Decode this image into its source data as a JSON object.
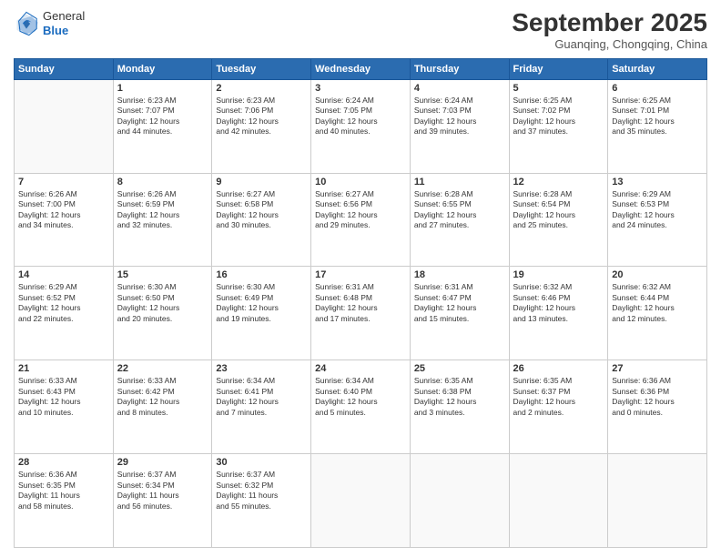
{
  "header": {
    "logo_general": "General",
    "logo_blue": "Blue",
    "month_title": "September 2025",
    "subtitle": "Guanqing, Chongqing, China"
  },
  "weekdays": [
    "Sunday",
    "Monday",
    "Tuesday",
    "Wednesday",
    "Thursday",
    "Friday",
    "Saturday"
  ],
  "weeks": [
    [
      {
        "day": "",
        "info": ""
      },
      {
        "day": "1",
        "info": "Sunrise: 6:23 AM\nSunset: 7:07 PM\nDaylight: 12 hours\nand 44 minutes."
      },
      {
        "day": "2",
        "info": "Sunrise: 6:23 AM\nSunset: 7:06 PM\nDaylight: 12 hours\nand 42 minutes."
      },
      {
        "day": "3",
        "info": "Sunrise: 6:24 AM\nSunset: 7:05 PM\nDaylight: 12 hours\nand 40 minutes."
      },
      {
        "day": "4",
        "info": "Sunrise: 6:24 AM\nSunset: 7:03 PM\nDaylight: 12 hours\nand 39 minutes."
      },
      {
        "day": "5",
        "info": "Sunrise: 6:25 AM\nSunset: 7:02 PM\nDaylight: 12 hours\nand 37 minutes."
      },
      {
        "day": "6",
        "info": "Sunrise: 6:25 AM\nSunset: 7:01 PM\nDaylight: 12 hours\nand 35 minutes."
      }
    ],
    [
      {
        "day": "7",
        "info": "Sunrise: 6:26 AM\nSunset: 7:00 PM\nDaylight: 12 hours\nand 34 minutes."
      },
      {
        "day": "8",
        "info": "Sunrise: 6:26 AM\nSunset: 6:59 PM\nDaylight: 12 hours\nand 32 minutes."
      },
      {
        "day": "9",
        "info": "Sunrise: 6:27 AM\nSunset: 6:58 PM\nDaylight: 12 hours\nand 30 minutes."
      },
      {
        "day": "10",
        "info": "Sunrise: 6:27 AM\nSunset: 6:56 PM\nDaylight: 12 hours\nand 29 minutes."
      },
      {
        "day": "11",
        "info": "Sunrise: 6:28 AM\nSunset: 6:55 PM\nDaylight: 12 hours\nand 27 minutes."
      },
      {
        "day": "12",
        "info": "Sunrise: 6:28 AM\nSunset: 6:54 PM\nDaylight: 12 hours\nand 25 minutes."
      },
      {
        "day": "13",
        "info": "Sunrise: 6:29 AM\nSunset: 6:53 PM\nDaylight: 12 hours\nand 24 minutes."
      }
    ],
    [
      {
        "day": "14",
        "info": "Sunrise: 6:29 AM\nSunset: 6:52 PM\nDaylight: 12 hours\nand 22 minutes."
      },
      {
        "day": "15",
        "info": "Sunrise: 6:30 AM\nSunset: 6:50 PM\nDaylight: 12 hours\nand 20 minutes."
      },
      {
        "day": "16",
        "info": "Sunrise: 6:30 AM\nSunset: 6:49 PM\nDaylight: 12 hours\nand 19 minutes."
      },
      {
        "day": "17",
        "info": "Sunrise: 6:31 AM\nSunset: 6:48 PM\nDaylight: 12 hours\nand 17 minutes."
      },
      {
        "day": "18",
        "info": "Sunrise: 6:31 AM\nSunset: 6:47 PM\nDaylight: 12 hours\nand 15 minutes."
      },
      {
        "day": "19",
        "info": "Sunrise: 6:32 AM\nSunset: 6:46 PM\nDaylight: 12 hours\nand 13 minutes."
      },
      {
        "day": "20",
        "info": "Sunrise: 6:32 AM\nSunset: 6:44 PM\nDaylight: 12 hours\nand 12 minutes."
      }
    ],
    [
      {
        "day": "21",
        "info": "Sunrise: 6:33 AM\nSunset: 6:43 PM\nDaylight: 12 hours\nand 10 minutes."
      },
      {
        "day": "22",
        "info": "Sunrise: 6:33 AM\nSunset: 6:42 PM\nDaylight: 12 hours\nand 8 minutes."
      },
      {
        "day": "23",
        "info": "Sunrise: 6:34 AM\nSunset: 6:41 PM\nDaylight: 12 hours\nand 7 minutes."
      },
      {
        "day": "24",
        "info": "Sunrise: 6:34 AM\nSunset: 6:40 PM\nDaylight: 12 hours\nand 5 minutes."
      },
      {
        "day": "25",
        "info": "Sunrise: 6:35 AM\nSunset: 6:38 PM\nDaylight: 12 hours\nand 3 minutes."
      },
      {
        "day": "26",
        "info": "Sunrise: 6:35 AM\nSunset: 6:37 PM\nDaylight: 12 hours\nand 2 minutes."
      },
      {
        "day": "27",
        "info": "Sunrise: 6:36 AM\nSunset: 6:36 PM\nDaylight: 12 hours\nand 0 minutes."
      }
    ],
    [
      {
        "day": "28",
        "info": "Sunrise: 6:36 AM\nSunset: 6:35 PM\nDaylight: 11 hours\nand 58 minutes."
      },
      {
        "day": "29",
        "info": "Sunrise: 6:37 AM\nSunset: 6:34 PM\nDaylight: 11 hours\nand 56 minutes."
      },
      {
        "day": "30",
        "info": "Sunrise: 6:37 AM\nSunset: 6:32 PM\nDaylight: 11 hours\nand 55 minutes."
      },
      {
        "day": "",
        "info": ""
      },
      {
        "day": "",
        "info": ""
      },
      {
        "day": "",
        "info": ""
      },
      {
        "day": "",
        "info": ""
      }
    ]
  ]
}
